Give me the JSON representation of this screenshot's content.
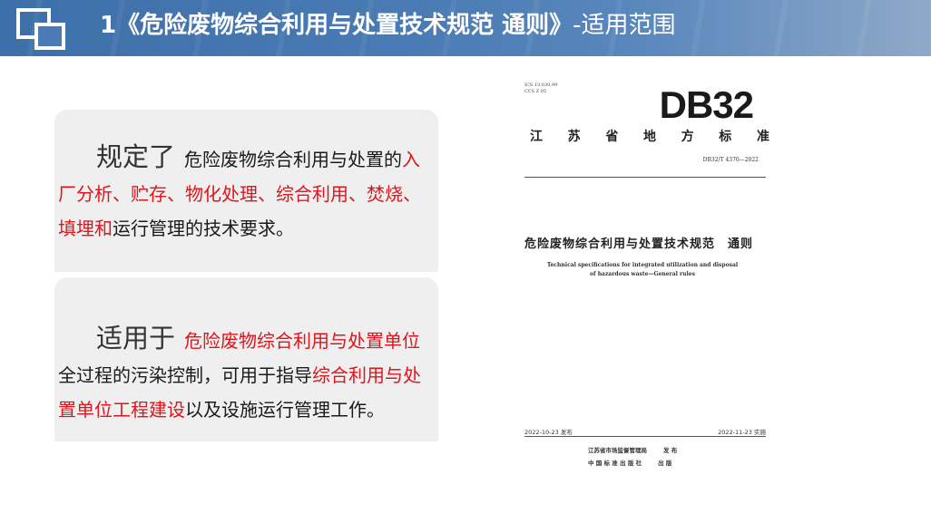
{
  "header": {
    "title_main": "1《危险废物综合利用与处置技术规范 通则》",
    "title_sub": "-适用范围"
  },
  "panel1": {
    "lead": "规定了",
    "text1": "危险废物综合利用与处置的",
    "red1": "入厂分析、贮存、物化处理、综合利用、焚烧、填埋和",
    "text2": "运行管理的技术要求。"
  },
  "panel2": {
    "lead": "适用于",
    "red1": "危险废物综合利用与处置单位",
    "text1": "全过程的污染控制，可用于指导",
    "red2": "综合利用与处置单位工程建设",
    "text2": "以及设施运行管理工作。"
  },
  "document": {
    "ics": "ICS 13.030.99",
    "ccs": "CCS Z 05",
    "code": "DB32",
    "province_chars": [
      "江",
      "苏",
      "省",
      "地",
      "方",
      "标",
      "准"
    ],
    "std_no": "DB32/T 4370—2022",
    "title_cn": "危险废物综合利用与处置技术规范　通则",
    "title_en_1": "Technical specifications for integrated utilization and disposal",
    "title_en_2": "of hazardous waste—General rules",
    "issue_date": "2022-10-23 发布",
    "impl_date": "2022-11-23 实施",
    "publisher1": "江苏省市场监督管理局",
    "publisher1_role": "发 布",
    "publisher2": "中 国 标 准 出 版 社",
    "publisher2_role": "出 版"
  },
  "colors": {
    "accent_red": "#e0141b",
    "header_blue": "#4a7bb4"
  },
  "icons": {
    "header_logo": "overlapping-squares-icon"
  }
}
